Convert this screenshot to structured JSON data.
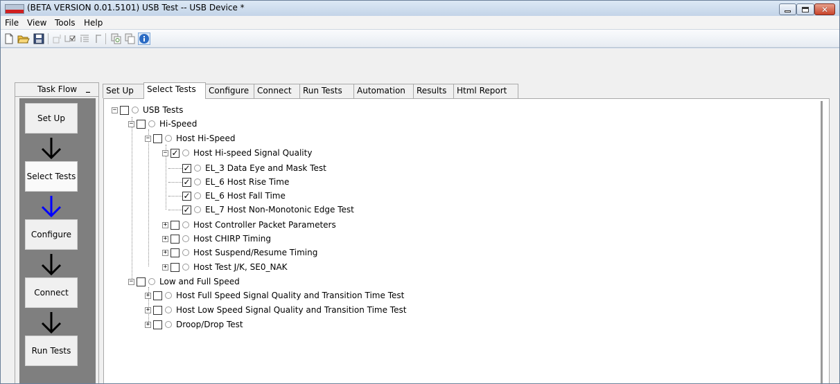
{
  "window": {
    "title": "(BETA VERSION 0.01.5101) USB Test -- USB Device *"
  },
  "menu": [
    "File",
    "View",
    "Tools",
    "Help"
  ],
  "toolbar": {
    "icons": [
      "new-file-icon",
      "open-folder-icon",
      "save-icon",
      "step-icon",
      "check-step-icon",
      "list-step-icon",
      "bracket-icon",
      "copy-icon",
      "paste-icon",
      "info-icon"
    ]
  },
  "taskflow": {
    "title": "Task Flow",
    "collapse": "_",
    "steps": [
      "Set Up",
      "Select Tests",
      "Configure",
      "Connect",
      "Run Tests"
    ]
  },
  "tabs": [
    "Set Up",
    "Select Tests",
    "Configure",
    "Connect",
    "Run Tests",
    "Automation",
    "Results",
    "Html Report"
  ],
  "tree": [
    {
      "label": "USB Tests",
      "checked": false,
      "expander": "−"
    },
    {
      "label": "Hi-Speed",
      "checked": false,
      "expander": "−"
    },
    {
      "label": "Host Hi-Speed",
      "checked": false,
      "expander": "−"
    },
    {
      "label": "Host Hi-speed Signal Quality",
      "checked": true,
      "expander": "−"
    },
    {
      "label": "EL_3 Data Eye and Mask Test",
      "checked": true,
      "expander": ""
    },
    {
      "label": "EL_6 Host Rise Time",
      "checked": true,
      "expander": ""
    },
    {
      "label": "EL_6 Host Fall Time",
      "checked": true,
      "expander": ""
    },
    {
      "label": "EL_7 Host Non-Monotonic Edge Test",
      "checked": true,
      "expander": ""
    },
    {
      "label": "Host Controller Packet Parameters",
      "checked": false,
      "expander": "+"
    },
    {
      "label": "Host CHIRP Timing",
      "checked": false,
      "expander": "+"
    },
    {
      "label": "Host Suspend/Resume Timing",
      "checked": false,
      "expander": "+"
    },
    {
      "label": "Host Test J/K, SE0_NAK",
      "checked": false,
      "expander": "+"
    },
    {
      "label": "Low and Full Speed",
      "checked": false,
      "expander": "−"
    },
    {
      "label": "Host Full Speed Signal Quality and Transition Time Test",
      "checked": false,
      "expander": "+"
    },
    {
      "label": "Host Low Speed Signal Quality and Transition Time Test",
      "checked": false,
      "expander": "+"
    },
    {
      "label": "Droop/Drop Test",
      "checked": false,
      "expander": "+"
    }
  ],
  "colors": {
    "titlebar": "#c9d9ec",
    "taskflow_bg": "#7f7f7f",
    "arrow_black": "#000000",
    "arrow_active": "#0000ff"
  }
}
